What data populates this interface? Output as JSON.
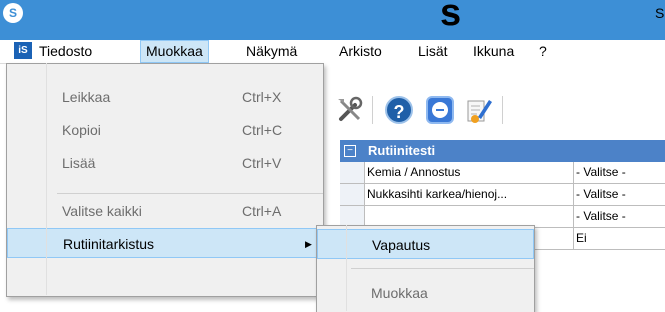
{
  "banner": {
    "title": "s",
    "right_char": "S"
  },
  "menubar": {
    "items": [
      "Tiedosto",
      "Muokkaa",
      "Näkymä",
      "Arkisto",
      "Lisät",
      "Ikkuna",
      "?"
    ]
  },
  "edit_menu": {
    "items": [
      {
        "label": "Leikkaa",
        "shortcut": "Ctrl+X",
        "enabled": false
      },
      {
        "label": "Kopioi",
        "shortcut": "Ctrl+C",
        "enabled": false
      },
      {
        "label": "Lisää",
        "shortcut": "Ctrl+V",
        "enabled": false
      },
      {
        "label": "Valitse kaikki",
        "shortcut": "Ctrl+A",
        "enabled": false
      },
      {
        "label": "Rutiinitarkistus",
        "shortcut": "",
        "enabled": true
      }
    ]
  },
  "submenu": {
    "items": [
      {
        "label": "Vapautus",
        "enabled": true
      },
      {
        "label": "Muokkaa",
        "enabled": false
      }
    ]
  },
  "toolbar": {
    "icons": [
      "tools-icon",
      "help-icon",
      "remote-support-icon",
      "edit-document-icon"
    ]
  },
  "grid": {
    "section": "Rutiinitesti",
    "rows": [
      {
        "key": "Kemia / Annostus",
        "value": "- Valitse -"
      },
      {
        "key": "Nukkasihti karkea/hienoj...",
        "value": "- Valitse -"
      },
      {
        "key": "",
        "value": "- Valitse -"
      },
      {
        "key": "",
        "value": "Ei"
      }
    ]
  },
  "colors": {
    "titlebar": "#3d8fd6",
    "highlight": "#cde6f7",
    "highlight_border": "#90c8f6",
    "grid_header": "#4c82c8"
  }
}
